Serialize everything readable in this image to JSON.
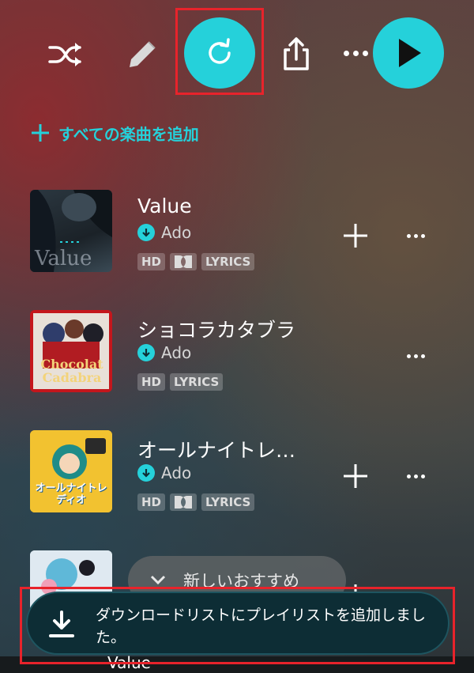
{
  "toolbar": {
    "shuffle_icon": "shuffle-icon",
    "edit_icon": "pencil-icon",
    "repeat_icon": "repeat-icon",
    "share_icon": "share-icon",
    "more_icon": "more-icon",
    "play_icon": "play-icon",
    "accent": "#25d1da",
    "highlight": "#e8232b"
  },
  "add_all": {
    "label": "すべての楽曲を追加"
  },
  "tracks": [
    {
      "title": "Value",
      "artist": "Ado",
      "badges": [
        "HD",
        "LYRICS"
      ],
      "dolby": true,
      "has_add": true
    },
    {
      "title": "ショコラカタブラ",
      "artist": "Ado",
      "badges": [
        "HD",
        "LYRICS"
      ],
      "dolby": false,
      "has_add": false,
      "art_text": "Chocolat Cadabra"
    },
    {
      "title": "オールナイトレ…",
      "artist": "Ado",
      "badges": [
        "HD",
        "LYRICS"
      ],
      "dolby": true,
      "has_add": true
    }
  ],
  "art_labels": {
    "track1": "Value",
    "track3": "オールナイトレディオ"
  },
  "recommend_pill": {
    "label": "新しいおすすめ"
  },
  "toast": {
    "message": "ダウンロードリストにプレイリストを追加しました。"
  },
  "mini_player": {
    "title": "Value"
  }
}
